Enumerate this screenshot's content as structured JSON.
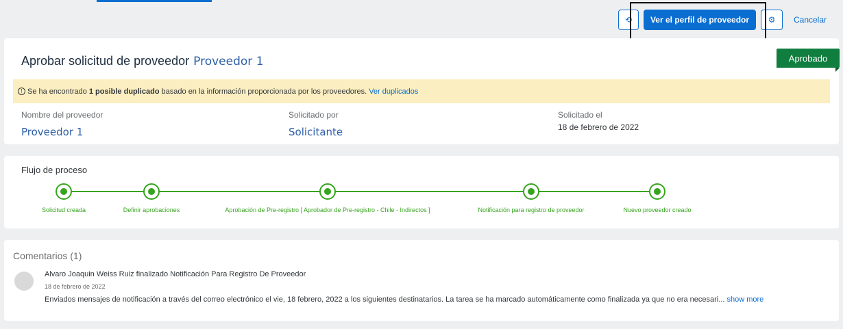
{
  "toolbar": {
    "primary_label": "Ver el perfil de proveedor",
    "cancel_label": "Cancelar",
    "refresh_icon": "refresh-icon",
    "gear_icon": "gear-icon"
  },
  "header": {
    "title": "Aprobar solicitud de proveedor",
    "subject": "Proveedor 1",
    "status": "Aprobado",
    "status_color": "#107e3e"
  },
  "warning": {
    "prefix": "Se ha encontrado",
    "highlight": "1 posible duplicado",
    "suffix": "basado en la información proporcionada por los proveedores.",
    "link": "Ver duplicados"
  },
  "fields": {
    "supplier_label": "Nombre del proveedor",
    "supplier_value": "Proveedor 1",
    "requester_label": "Solicitado por",
    "requester_value": "Solicitante",
    "date_label": "Solicitado el",
    "date_value": "18 de febrero de 2022"
  },
  "flow": {
    "title": "Flujo de proceso",
    "steps": [
      "Solicitud creada",
      "Definir aprobaciones",
      "Aprobación de Pre-registro [ Aprobador de Pre-registro - Chile - Indirectos ]",
      "Notificación para registro de proveedor",
      "Nuevo proveedor creado"
    ],
    "color": "#36a41d"
  },
  "comments": {
    "title": "Comentarios (1)",
    "items": [
      {
        "author": "Alvaro Joaquin Weiss Ruiz finalizado Notificación Para Registro De Proveedor",
        "date": "18 de febrero de 2022",
        "body": "Enviados mensajes de notificación a través del correo electrónico el vie, 18 febrero, 2022 a los siguientes destinatarios. La tarea se ha marcado automáticamente como finalizada ya que no era necesari...",
        "more": "show more"
      }
    ]
  }
}
